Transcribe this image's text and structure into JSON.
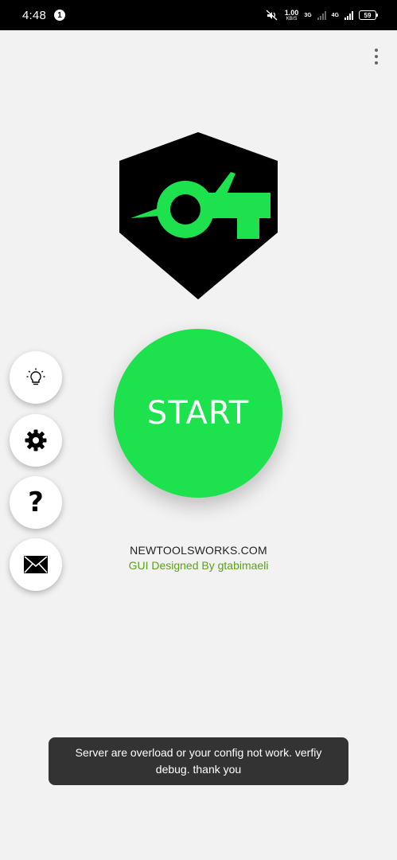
{
  "status_bar": {
    "time": "4:48",
    "notification_count": "1",
    "net_speed_value": "1.00",
    "net_speed_unit": "KB/S",
    "network_1": "3G",
    "network_2": "4G",
    "battery": "59",
    "icons": [
      "mute-icon",
      "signal-icon",
      "battery-icon"
    ]
  },
  "menu": {
    "icon": "more-vertical-icon"
  },
  "logo": {
    "colors": {
      "shield": "#000000",
      "mark": "#1ee14e"
    }
  },
  "start_button": {
    "label": "START",
    "color": "#1ee14e"
  },
  "side_actions": [
    {
      "icon": "lightbulb-icon"
    },
    {
      "icon": "gear-icon"
    },
    {
      "icon": "help-icon",
      "glyph": "?"
    },
    {
      "icon": "mail-icon"
    }
  ],
  "credits": {
    "site": "NEWTOOLSWORKS.COM",
    "designer": "GUI  Designed By gtabimaeli",
    "designer_color": "#5aa21a"
  },
  "toast": {
    "message": "Server are overload or your config not work. verfiy debug. thank you"
  }
}
